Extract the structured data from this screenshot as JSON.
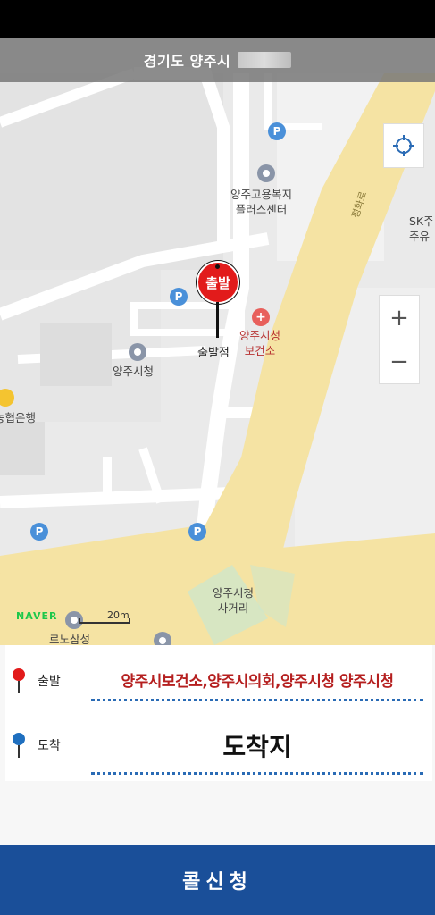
{
  "header": {
    "location": "경기도 양주시"
  },
  "map": {
    "labels": {
      "employment_center": "양주고용복지\n플러스센터",
      "city_hall": "양주시청",
      "health_center": "양주시청\n보건소",
      "bank": "농협은행",
      "sk": "SK주\n주유",
      "intersection": "양주시청\n사거리",
      "road": "평화로",
      "bottom_poi": "르노삼성"
    },
    "start_pin": {
      "label": "출발",
      "point_label": "출발점"
    },
    "naver_logo": "NAVER",
    "scale": "20m",
    "buttons": {
      "zoom_in": "+",
      "zoom_out": "−"
    },
    "icons": [
      "crosshair-icon",
      "parking-icon",
      "government-icon",
      "hospital-icon",
      "bank-icon"
    ]
  },
  "route": {
    "start": {
      "label": "출발",
      "value": "양주시보건소,양주시의회,양주시청 양주시청"
    },
    "end": {
      "label": "도착",
      "value": "도착지"
    }
  },
  "call_button": {
    "label": "콜신청"
  },
  "colors": {
    "start_pin": "#e21b1b",
    "end_pin": "#1f6fbf",
    "start_value": "#b51f1f",
    "call_button_bg": "#1a4f99",
    "dotted_line": "#2a6bb5",
    "road": "#f5e3a3"
  }
}
